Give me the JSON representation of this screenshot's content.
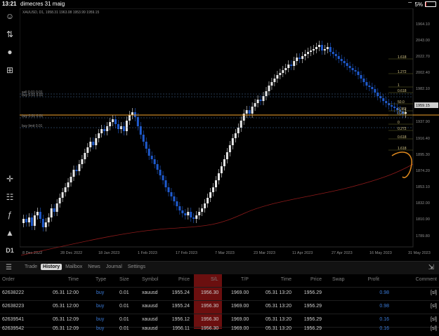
{
  "status": {
    "time": "13:21",
    "date": "dimecres 31 maig",
    "battery": "5%"
  },
  "toolbar": [
    {
      "name": "profile-icon",
      "glyph": "☺"
    },
    {
      "name": "trade-arrows-icon",
      "glyph": "⇅"
    },
    {
      "name": "chat-icon",
      "glyph": "●"
    },
    {
      "name": "add-icon",
      "glyph": "⊞"
    },
    {
      "name": "crosshair-icon",
      "glyph": "✛"
    },
    {
      "name": "indicators-icon",
      "glyph": "☷"
    },
    {
      "name": "function-icon",
      "glyph": "ƒ"
    },
    {
      "name": "objects-icon",
      "glyph": "▲"
    }
  ],
  "toolbar_timeframe": "D1",
  "chart": {
    "symbol_info": "XAUUSD, D1, 1958.31 1963.08 1953.99 1959.15",
    "price_labels": [
      "1964.10",
      "2043.00",
      "2022.70",
      "2002.40",
      "1982.10",
      "1959.15",
      "1937.90",
      "1916.40",
      "1895.30",
      "1874.20",
      "1853.10",
      "1832.00",
      "1810.90",
      "1789.80"
    ],
    "date_labels": [
      "8 Dec 2022",
      "28 Dec 2022",
      "18 Jan 2023",
      "1 Feb 2023",
      "17 Feb 2023",
      "7 Mar 2023",
      "23 Mar 2023",
      "11 Apr 2023",
      "27 Apr 2023",
      "16 May 2023",
      "31 May 2023"
    ],
    "current_price": "1959.15",
    "order_lines": [
      {
        "label": "sell 0.01 0.01",
        "color": "#4a6fa0"
      },
      {
        "label": "buy 0.01 0.01",
        "color": "#4a6fa0"
      },
      {
        "label": "buy 0.01 0.01",
        "color": "#4a6fa0"
      },
      {
        "label": "buy limit 0.01",
        "color": "#4a6fa0"
      }
    ],
    "fibo_labels": [
      "1.618",
      "1.272",
      "1",
      "0.618",
      "50.0",
      "0.382",
      "0.236",
      "0",
      "0.272",
      "0.618",
      "1.618"
    ],
    "colors": {
      "bull": "#e8e8e8",
      "bear": "#1f5bcf",
      "ma": "#8e1a1a",
      "hline": "#f2a22a",
      "annotation": "#e08a1e"
    }
  },
  "tabs": [
    "Trade",
    "History",
    "Mailbox",
    "News",
    "Journal",
    "Settings"
  ],
  "table": {
    "headers": [
      "Order",
      "Time",
      "Type",
      "Size",
      "Symbol",
      "Price",
      "S/L",
      "T/P",
      "Time",
      "Price",
      "Swap",
      "Profit",
      "Comment"
    ],
    "rows": [
      [
        "62638222",
        "05.31 12:00",
        "buy",
        "0.01",
        "xauusd",
        "1955.24",
        "1956.30",
        "1969.00",
        "05.31 13:20",
        "1956.29",
        "",
        "0.98",
        "[sl]"
      ],
      [
        "62638223",
        "05.31 12:00",
        "buy",
        "0.01",
        "xauusd",
        "1955.24",
        "1956.30",
        "1969.00",
        "05.31 13:20",
        "1956.29",
        "",
        "0.98",
        "[sl]"
      ],
      [
        "62639541",
        "05.31 12:09",
        "buy",
        "0.01",
        "xauusd",
        "1956.12",
        "1956.30",
        "1969.00",
        "05.31 13:20",
        "1956.29",
        "",
        "0.16",
        "[sl]"
      ],
      [
        "62639542",
        "05.31 12:09",
        "buy",
        "0.01",
        "xauusd",
        "1956.11",
        "1956.30",
        "1969.00",
        "05.31 13:20",
        "1956.29",
        "",
        "0.16",
        "[sl]"
      ]
    ]
  }
}
